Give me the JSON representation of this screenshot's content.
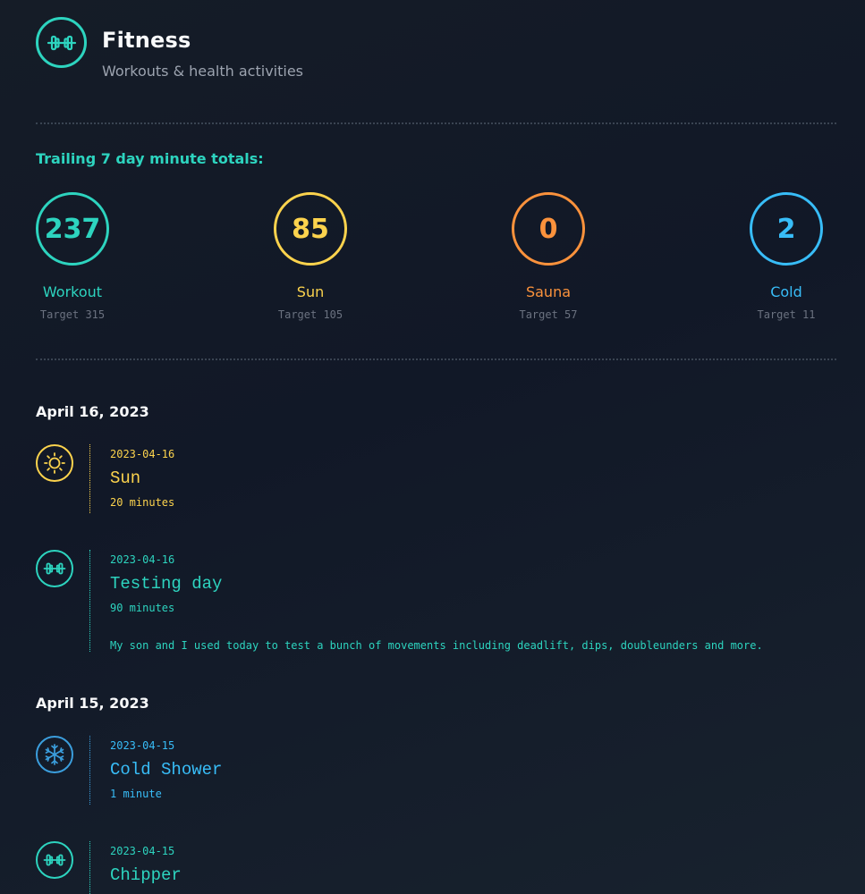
{
  "header": {
    "title": "Fitness",
    "subtitle": "Workouts & health activities",
    "icon": "dumbbell-icon"
  },
  "stats": {
    "heading": "Trailing 7 day minute totals:",
    "items": [
      {
        "value": "237",
        "label": "Workout",
        "target": "Target 315",
        "color": "#2dd4bf"
      },
      {
        "value": "85",
        "label": "Sun",
        "target": "Target 105",
        "color": "#fcd34d"
      },
      {
        "value": "0",
        "label": "Sauna",
        "target": "Target 57",
        "color": "#fb923c"
      },
      {
        "value": "2",
        "label": "Cold",
        "target": "Target 11",
        "color": "#38bdf8"
      }
    ]
  },
  "days": [
    {
      "heading": "April 16, 2023",
      "entries": [
        {
          "icon": "sun-icon",
          "date": "2023-04-16",
          "title": "Sun",
          "duration": "20 minutes",
          "color": "#fcd34d"
        },
        {
          "icon": "dumbbell-icon",
          "date": "2023-04-16",
          "title": "Testing day",
          "duration": "90 minutes",
          "note": "My son and I used today to test a bunch of movements including deadlift, dips, doubleunders and more.",
          "color": "#2dd4bf"
        }
      ]
    },
    {
      "heading": "April 15, 2023",
      "entries": [
        {
          "icon": "snowflake-icon",
          "date": "2023-04-15",
          "title": "Cold Shower",
          "duration": "1 minute",
          "color": "#38bdf8"
        },
        {
          "icon": "dumbbell-icon",
          "date": "2023-04-15",
          "title": "Chipper",
          "color": "#2dd4bf"
        }
      ]
    }
  ]
}
